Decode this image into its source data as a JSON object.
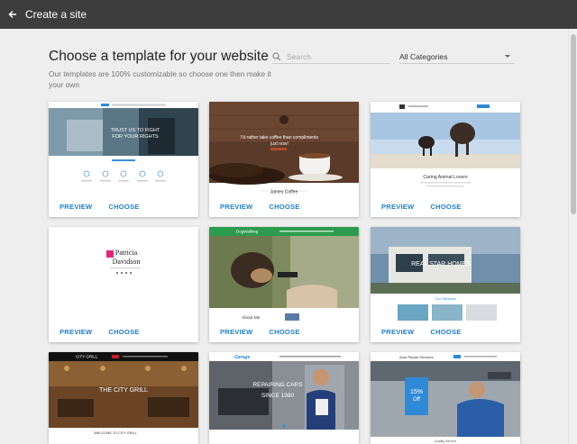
{
  "topbar": {
    "title": "Create a site"
  },
  "header": {
    "title": "Choose a template for your website",
    "subtitle": "Our templates are 100% customizable so choose one then make it your own"
  },
  "search": {
    "placeholder": "Search",
    "value": ""
  },
  "category": {
    "selected": "All Categories"
  },
  "card_actions": {
    "preview": "PREVIEW",
    "choose": "CHOOSE"
  },
  "templates": [
    {
      "id": "business",
      "thumb_text": [
        "TRUST US TO FIGHT",
        "FOR YOUR RIGHTS"
      ]
    },
    {
      "id": "coffee",
      "thumb_text": [
        "I'd rather take coffee than compliments",
        "just now!",
        "James Coffee"
      ]
    },
    {
      "id": "dog",
      "thumb_text": [
        "Caring Animal Lovers"
      ]
    },
    {
      "id": "personal",
      "thumb_text": [
        "Patricia",
        "Davidson"
      ]
    },
    {
      "id": "dogwalk",
      "thumb_text": [
        "DogWalking",
        "About Me"
      ]
    },
    {
      "id": "realstar",
      "thumb_text": [
        "REAL STAR HOMES",
        "Our Services"
      ]
    },
    {
      "id": "citygrill",
      "thumb_text": [
        "CITY GRILL",
        "THE CITY GRILL",
        "WELCOME TO CITY GRILL"
      ]
    },
    {
      "id": "garage",
      "thumb_text": [
        "Garage",
        "REPAIRING CARS",
        "SINCE 1980"
      ]
    },
    {
      "id": "autorepair",
      "thumb_text": [
        "Auto Repair Services",
        "15%",
        "Off",
        "Quality Service"
      ]
    }
  ]
}
